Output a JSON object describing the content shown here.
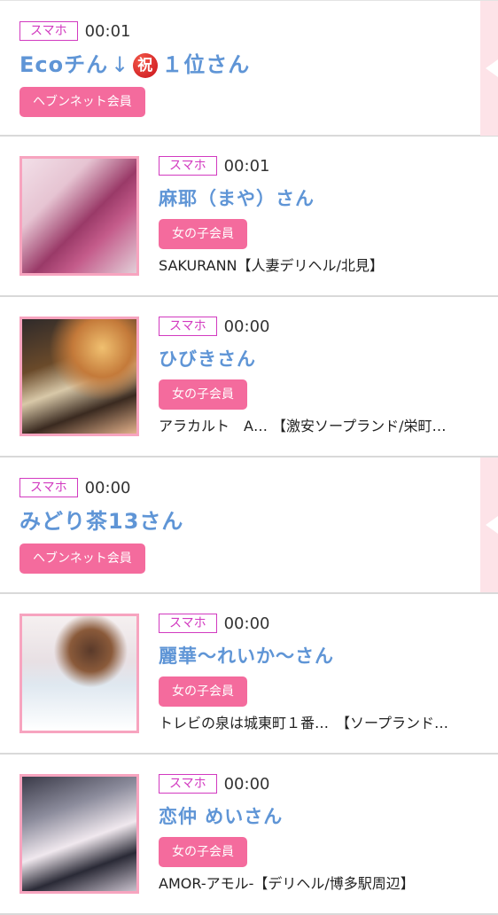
{
  "entries": [
    {
      "device": "スマホ",
      "time": "00:01",
      "name": "Ecoチん",
      "arrow": "↓",
      "celebrate": "祝",
      "name_suffix": "１位さん",
      "role": "ヘブンネット会員"
    },
    {
      "device": "スマホ",
      "time": "00:01",
      "name": "麻耶（まや）さん",
      "role": "女の子会員",
      "shop": "SAKURANN【人妻デリヘル/北見】"
    },
    {
      "device": "スマホ",
      "time": "00:00",
      "name": "ひびきさん",
      "role": "女の子会員",
      "shop": "アラカルト　A… 【激安ソープランド/栄町…"
    },
    {
      "device": "スマホ",
      "time": "00:00",
      "name": "みどり茶13さん",
      "role": "ヘブンネット会員"
    },
    {
      "device": "スマホ",
      "time": "00:00",
      "name": "麗華〜れいか〜さん",
      "role": "女の子会員",
      "shop": "トレビの泉は城東町１番…　【ソープランド…"
    },
    {
      "device": "スマホ",
      "time": "00:00",
      "name": "恋仲 めいさん",
      "role": "女の子会員",
      "shop": "AMOR-アモル-【デリヘル/博多駅周辺】"
    }
  ],
  "icons": {
    "celebrate": "celebrate-icon",
    "side_tab": "side-tab-arrow"
  },
  "colors": {
    "device_badge": "#d23ac0",
    "name": "#5f95d6",
    "role_button": "#f46b9d",
    "thumb_border": "#f7a4bf"
  }
}
